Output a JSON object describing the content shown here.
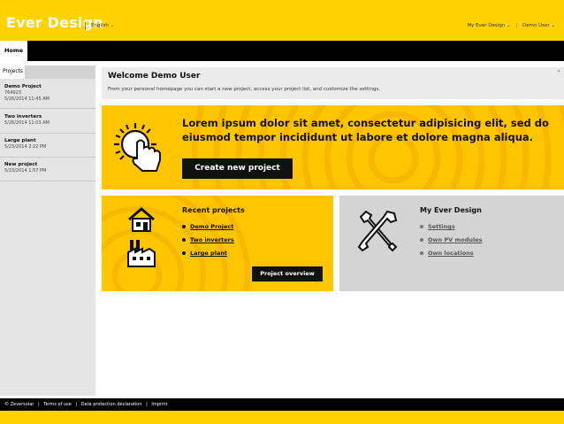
{
  "header": {
    "logo": "Ever Design",
    "language": "English ⌄",
    "my_account_menu": "My Ever Design ⌄",
    "user_menu": "Demo User ⌄",
    "divider": "|"
  },
  "nav": {
    "home": "Home"
  },
  "sidebar": {
    "tab": "Projects",
    "projects": [
      {
        "name": "Demo Project",
        "id": "764923",
        "date": "5/26/2014 11:45 AM"
      },
      {
        "name": "Two inverters",
        "id": "",
        "date": "5/26/2014 11:03 AM"
      },
      {
        "name": "Large plant",
        "id": "",
        "date": "5/23/2014 2:22 PM"
      },
      {
        "name": "New project",
        "id": "",
        "date": "5/23/2014 1:57 PM"
      }
    ]
  },
  "welcome": {
    "title": "Welcome Demo User",
    "text": "From your personal homepage you can start a new project, access your project list, and customize the settings.",
    "collapse": "˄"
  },
  "hero": {
    "text": "Lorem ipsum dolor sit amet, consectetur adipisicing elit, sed do eiusmod tempor incididunt ut labore et dolore magna aliqua.",
    "button": "Create new project"
  },
  "recent": {
    "title": "Recent projects",
    "links": [
      "Demo Project",
      "Two inverters",
      "Large plant"
    ],
    "button": "Project overview"
  },
  "my_ever": {
    "title": "My Ever Design",
    "links": [
      "Settings",
      "Own PV modules",
      "Own locations"
    ]
  },
  "footer": {
    "copyright": "© Zeversolar",
    "terms": "Terms of use",
    "privacy": "Data protection declaration",
    "imprint": "Imprint",
    "sep": "|"
  },
  "colors": {
    "brand_yellow": "#ffd200",
    "card_yellow": "#ffc600",
    "black": "#000000",
    "gray_panel": "#ebebeb"
  },
  "icons": [
    "sun-touch-icon",
    "house-icon",
    "factory-icon",
    "tools-icon",
    "chevron-up-icon"
  ]
}
